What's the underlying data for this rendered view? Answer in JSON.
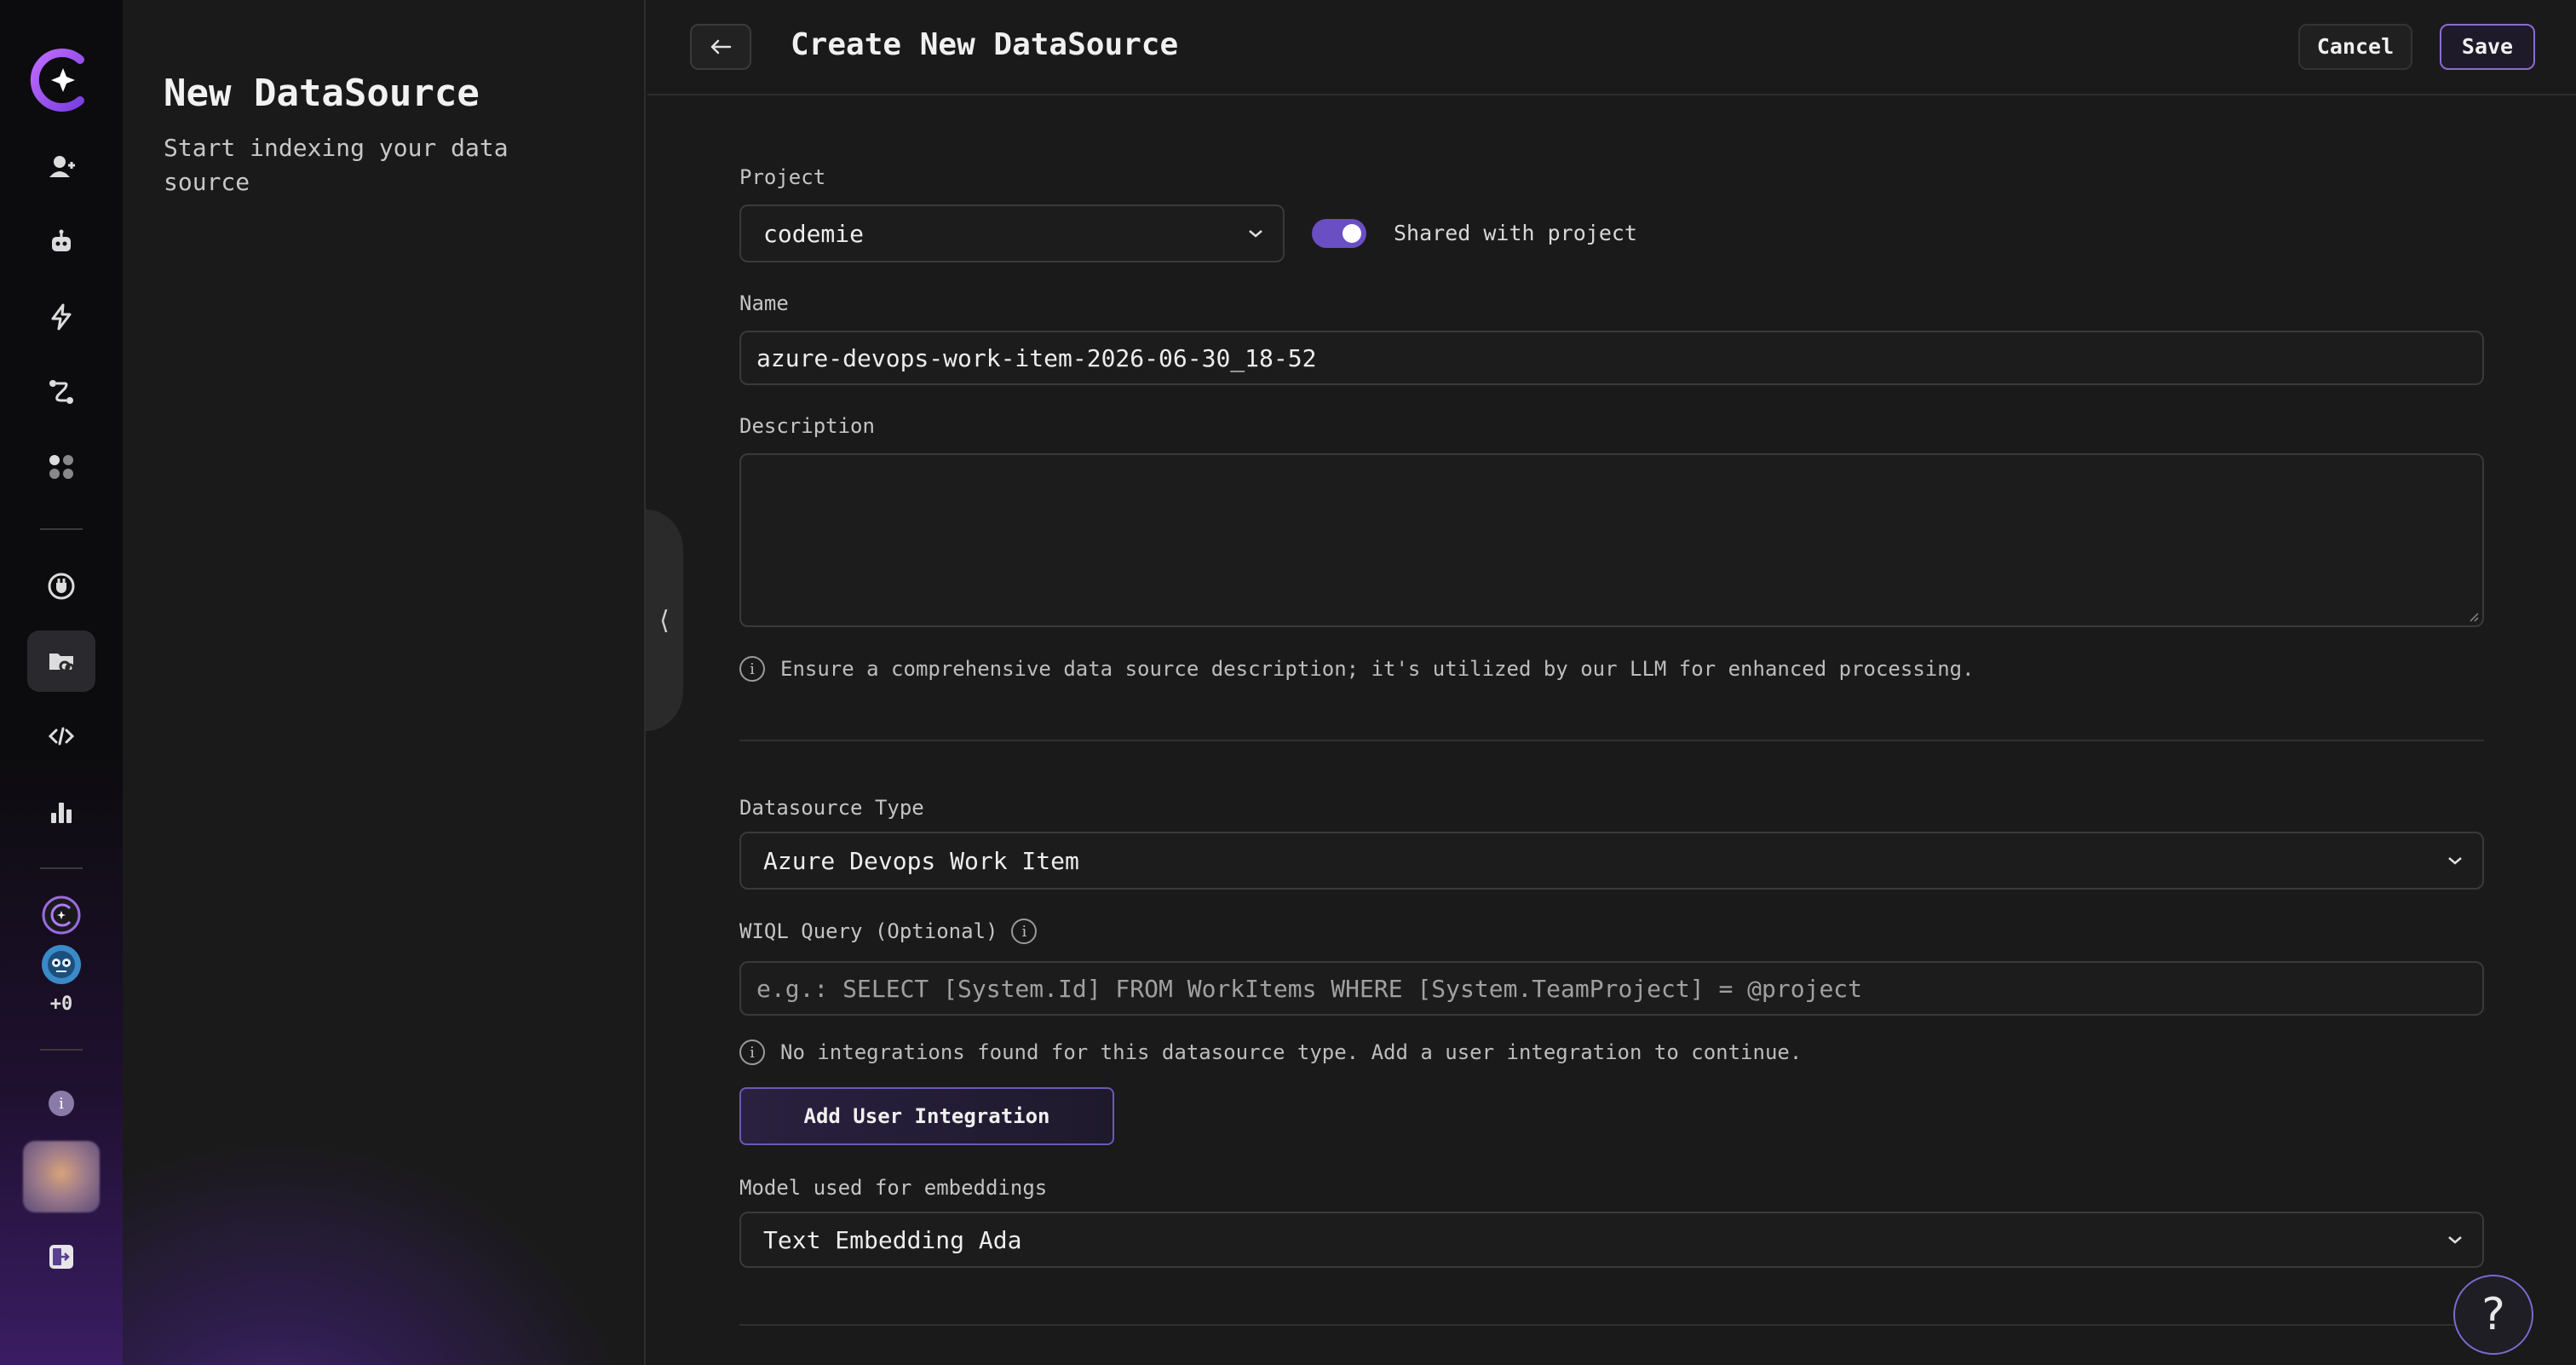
{
  "panel": {
    "title": "New DataSource",
    "subtitle": "Start indexing your data source"
  },
  "sidebar": {
    "extra_count": "+0",
    "items": [
      {
        "icon": "assistant-add-icon"
      },
      {
        "icon": "robot-icon"
      },
      {
        "icon": "lightning-icon"
      },
      {
        "icon": "workflow-icon"
      },
      {
        "icon": "apps-grid-icon"
      },
      {
        "icon": "integrations-icon"
      },
      {
        "icon": "datasource-icon",
        "active": true
      },
      {
        "icon": "code-icon"
      },
      {
        "icon": "analytics-icon"
      }
    ]
  },
  "header": {
    "title": "Create New DataSource",
    "cancel_label": "Cancel",
    "save_label": "Save"
  },
  "form": {
    "project_label": "Project",
    "project_value": "codemie",
    "shared_label": "Shared with project",
    "shared_on": true,
    "name_label": "Name",
    "name_value": "azure-devops-work-item-2026-06-30_18-52",
    "description_label": "Description",
    "description_value": "",
    "description_hint": "Ensure a comprehensive data source description; it's utilized by our LLM for enhanced processing.",
    "type_label": "Datasource Type",
    "type_value": "Azure Devops Work Item",
    "wiql_label": "WIQL Query (Optional)",
    "wiql_placeholder": "e.g.: SELECT [System.Id] FROM WorkItems WHERE [System.TeamProject] = @project",
    "integration_hint": "No integrations found for this datasource type. Add a user integration to continue.",
    "add_integration_label": "Add User Integration",
    "embeddings_label": "Model used for embeddings",
    "embeddings_value": "Text Embedding Ada"
  },
  "help_label": "?",
  "colors": {
    "accent": "#7b5ce0",
    "background": "#1a1a1a"
  }
}
